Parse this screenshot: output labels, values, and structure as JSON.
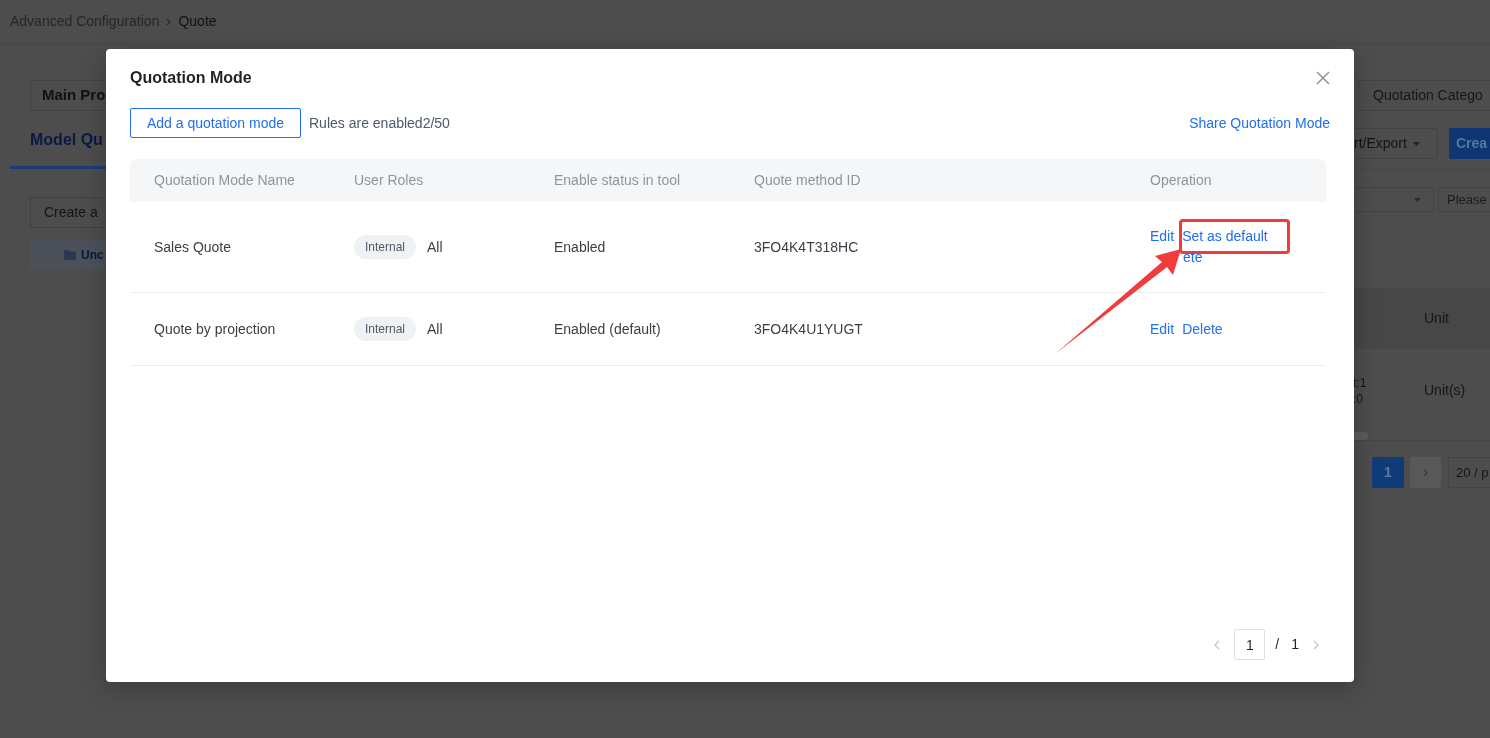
{
  "background_page": {
    "breadcrumb": [
      {
        "label": "Advanced Configuration",
        "current": false
      },
      {
        "label": "Quote",
        "current": true
      }
    ],
    "product_select": "Main Pro",
    "tab": {
      "label": "Model Qu",
      "selected": true
    },
    "create_button": "Create a",
    "tree_item": {
      "label": "Unc",
      "selected": true
    },
    "category_select": "Quotation Catego",
    "import_export_button": "rt/Export",
    "create_primary_button": "Crea",
    "filter_placeholder": "Please",
    "table": {
      "columns": [
        "Unit"
      ],
      "rows": [
        {
          "column_1": [
            "t:1",
            ":0"
          ],
          "unit": "Unit(s)"
        }
      ]
    },
    "pagination": {
      "pages": [
        {
          "label": "1",
          "selected": true
        }
      ],
      "next": {
        "disabled": true
      },
      "page_size": "20 / p"
    }
  },
  "modal": {
    "title": "Quotation Mode",
    "add_button": "Add a quotation mode",
    "rules_count": "Rules are enabled2/50",
    "share_link": "Share Quotation Mode",
    "table": {
      "columns": [
        "Quotation Mode Name",
        "User Roles",
        "Enable status in tool",
        "Quote method ID",
        "Operation"
      ],
      "rows": [
        {
          "name": "Sales Quote",
          "role_tag": "Internal",
          "roles": "All",
          "status": "Enabled",
          "id": "3FO4K4T318HC",
          "operations": [
            {
              "label": "Edit",
              "highlighted": false
            },
            {
              "label": "Set as default",
              "highlighted": true
            },
            {
              "label": "ete",
              "highlighted": false
            }
          ]
        },
        {
          "name": "Quote by projection",
          "role_tag": "Internal",
          "roles": "All",
          "status": "Enabled (default)",
          "id": "3FO4K4U1YUGT",
          "operations": [
            {
              "label": "Edit",
              "highlighted": false
            },
            {
              "label": "Delete",
              "highlighted": false
            }
          ]
        }
      ]
    },
    "pagination": {
      "prev": {
        "disabled": true
      },
      "current": "1",
      "separator": "/",
      "total": "1",
      "next": {
        "disabled": true
      }
    }
  }
}
